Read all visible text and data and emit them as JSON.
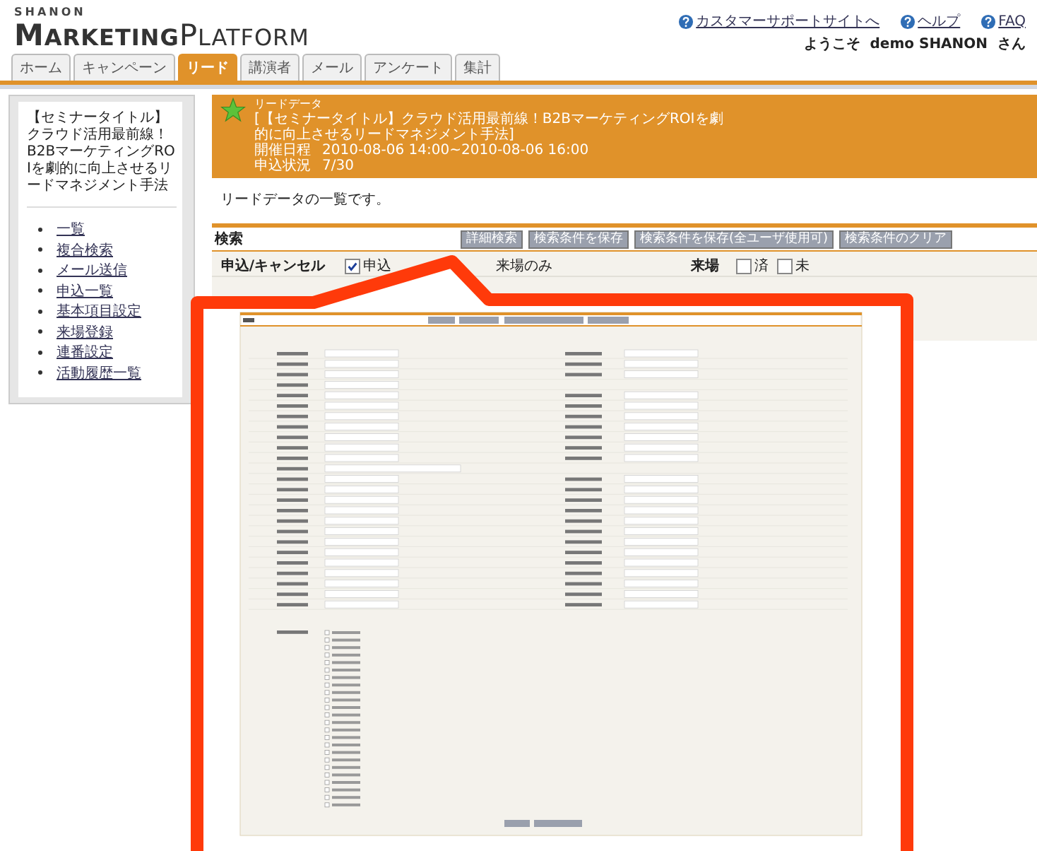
{
  "header": {
    "brand_small": "SHANON",
    "brand_bold": "MARKETING",
    "brand_light": "PLATFORM",
    "links": [
      {
        "label": "カスタマーサポートサイトへ"
      },
      {
        "label": "ヘルプ"
      },
      {
        "label": "FAQ"
      }
    ],
    "welcome": "ようこそ  demo SHANON  さん"
  },
  "tabs": [
    {
      "label": "ホーム",
      "selected": false
    },
    {
      "label": "キャンペーン",
      "selected": false
    },
    {
      "label": "リード",
      "selected": true
    },
    {
      "label": "講演者",
      "selected": false
    },
    {
      "label": "メール",
      "selected": false
    },
    {
      "label": "アンケート",
      "selected": false
    },
    {
      "label": "集計",
      "selected": false
    }
  ],
  "sidebar": {
    "title": "【セミナータイトル】クラウド活用最前線！B2BマーケティングROIを劇的に向上させるリードマネジメント手法",
    "items": [
      "一覧",
      "複合検索",
      "メール送信",
      "申込一覧",
      "基本項目設定",
      "来場登録",
      "連番設定",
      "活動履歴一覧"
    ]
  },
  "banner": {
    "label": "リードデータ",
    "title": "[【セミナータイトル】クラウド活用最前線！B2BマーケティングROIを劇的に向上させるリードマネジメント手法]",
    "facts": [
      {
        "label": "開催日程",
        "value": "2010-08-06 14:00~2010-08-06 16:00"
      },
      {
        "label": "申込状況",
        "value": "7/30"
      }
    ]
  },
  "intro": "リードデータの一覧です。",
  "search": {
    "title": "検索",
    "buttons": [
      "詳細検索",
      "検索条件を保存",
      "検索条件を保存(全ユーザ使用可)",
      "検索条件のクリア"
    ],
    "fields": [
      {
        "label": "申込/キャンセル",
        "options": [
          {
            "label": "申込",
            "checked": true
          },
          {
            "label": "来場のみ"
          }
        ]
      },
      {
        "label": "来場",
        "options": [
          {
            "label": "済",
            "checked": false
          },
          {
            "label": "未",
            "checked": false
          }
        ]
      }
    ]
  }
}
